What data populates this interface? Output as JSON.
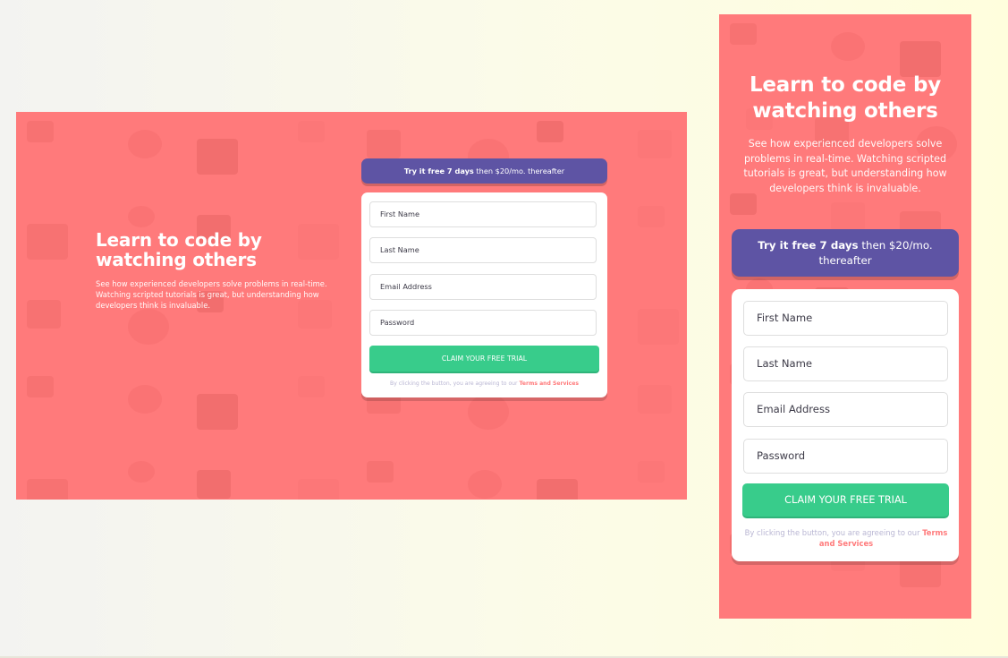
{
  "colors": {
    "background_coral": "#ff7a7b",
    "promo_purple": "#5e54a4",
    "cta_green": "#38cc8b",
    "terms_text": "#b9b6d3"
  },
  "desktop": {
    "heading": "Learn to code by watching others",
    "description": "See how experienced developers solve problems in real-time. Watching scripted tutorials is great, but understanding how developers think is invaluable.",
    "promo": {
      "bold": "Try it free 7 days",
      "rest": " then $20/mo. thereafter"
    },
    "form": {
      "fields": [
        "First Name",
        "Last Name",
        "Email Address",
        "Password"
      ],
      "cta": "CLAIM YOUR FREE TRIAL",
      "terms_prefix": "By clicking the button, you are agreeing to our ",
      "terms_link": "Terms and Services"
    }
  },
  "mobile": {
    "heading": "Learn to code by watching others",
    "description": "See how experienced developers solve problems in real-time. Watching scripted tutorials is great, but understanding how developers think is invaluable.",
    "promo": {
      "bold": "Try it free 7 days",
      "rest": " then $20/mo. thereafter"
    },
    "form": {
      "fields": [
        "First Name",
        "Last Name",
        "Email Address",
        "Password"
      ],
      "cta": "CLAIM YOUR FREE TRIAL",
      "terms_prefix": "By clicking the button, you are agreeing to our ",
      "terms_link": "Terms and Services"
    }
  }
}
